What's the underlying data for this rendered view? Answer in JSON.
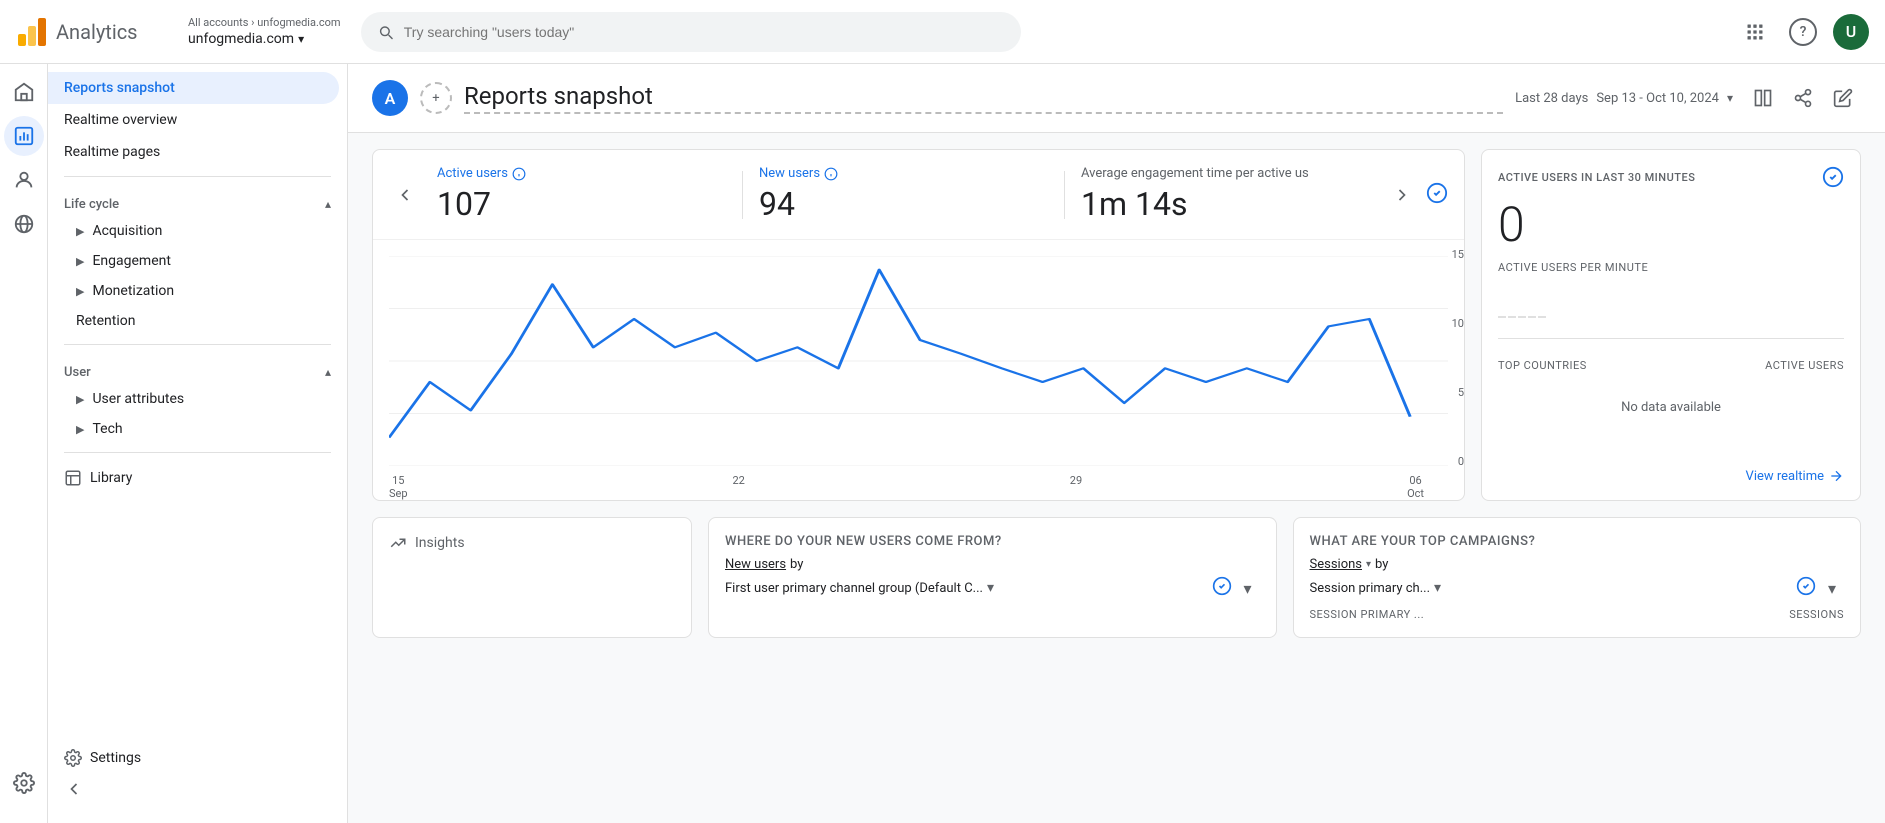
{
  "topbar": {
    "logo_text": "Analytics",
    "account_path": "All accounts › unfogmedia.com",
    "account_name": "unfogmedia.com",
    "search_placeholder": "Try searching \"users today\"",
    "avatar_letter": "U"
  },
  "sidebar_icons": [
    {
      "name": "home-icon",
      "symbol": "⌂"
    },
    {
      "name": "reports-icon",
      "symbol": "📊",
      "active": true
    },
    {
      "name": "audience-icon",
      "symbol": "👤"
    },
    {
      "name": "settings-icon-2",
      "symbol": "⚙"
    }
  ],
  "nav": {
    "main_items": [
      {
        "label": "Reports snapshot",
        "active": true
      },
      {
        "label": "Realtime overview",
        "active": false
      },
      {
        "label": "Realtime pages",
        "active": false
      }
    ],
    "sections": [
      {
        "label": "Life cycle",
        "expanded": true,
        "items": [
          {
            "label": "Acquisition",
            "expandable": true
          },
          {
            "label": "Engagement",
            "expandable": true
          },
          {
            "label": "Monetization",
            "expandable": true
          },
          {
            "label": "Retention",
            "expandable": false
          }
        ]
      },
      {
        "label": "User",
        "expanded": true,
        "items": [
          {
            "label": "User attributes",
            "expandable": true
          },
          {
            "label": "Tech",
            "expandable": true
          }
        ]
      }
    ],
    "library_item": "Library",
    "settings_item": "Settings",
    "collapse_tooltip": "Collapse"
  },
  "page_header": {
    "avatar_letter": "A",
    "title": "Reports snapshot",
    "date_range_label": "Last 28 days",
    "date_range": "Sep 13 - Oct 10, 2024"
  },
  "metrics": [
    {
      "label": "Active users",
      "value": "107",
      "has_info": true
    },
    {
      "label": "New users",
      "value": "94",
      "has_info": true
    },
    {
      "label": "Average engagement time per active us",
      "value": "1m 14s",
      "has_info": false
    }
  ],
  "chart": {
    "y_labels": [
      "15",
      "10",
      "5",
      "0"
    ],
    "x_labels": [
      {
        "date": "15",
        "month": "Sep"
      },
      {
        "date": "22",
        "month": ""
      },
      {
        "date": "29",
        "month": ""
      },
      {
        "date": "06",
        "month": "Oct"
      }
    ],
    "line_color": "#1a73e8",
    "points": [
      [
        0,
        4
      ],
      [
        4,
        7
      ],
      [
        8,
        5
      ],
      [
        12,
        9
      ],
      [
        16,
        13
      ],
      [
        20,
        8
      ],
      [
        24,
        10
      ],
      [
        28,
        7
      ],
      [
        32,
        8
      ],
      [
        36,
        6
      ],
      [
        40,
        7
      ],
      [
        44,
        5
      ],
      [
        48,
        14
      ],
      [
        52,
        7
      ],
      [
        56,
        6
      ],
      [
        60,
        5
      ],
      [
        64,
        4
      ],
      [
        68,
        5
      ],
      [
        72,
        3
      ],
      [
        76,
        5
      ],
      [
        80,
        4
      ],
      [
        84,
        5
      ],
      [
        88,
        4
      ],
      [
        92,
        10
      ],
      [
        96,
        11
      ],
      [
        100,
        3
      ]
    ]
  },
  "realtime": {
    "section_title": "ACTIVE USERS IN LAST 30 MINUTES",
    "big_number": "0",
    "sub_title": "ACTIVE USERS PER MINUTE",
    "table_title": "TOP COUNTRIES",
    "table_col2": "ACTIVE USERS",
    "no_data": "No data available",
    "view_realtime_label": "View realtime"
  },
  "bottom_section": [
    {
      "id": "insights",
      "icon": "insights-icon",
      "label": "Insights",
      "show_title": false
    },
    {
      "id": "new-users-source",
      "title": "WHERE DO YOUR NEW USERS COME FROM?",
      "sub1": "New users",
      "sub1_suffix": "by",
      "sub2": "First user primary channel group (Default C...",
      "has_check": true,
      "has_dropdown": true
    },
    {
      "id": "top-campaigns",
      "title": "WHAT ARE YOUR TOP CAMPAIGNS?",
      "sub1": "Sessions",
      "sub1_suffix": "by",
      "sub2": "Session primary ch...",
      "col_label": "SESSION PRIMARY ...",
      "col2_label": "SESSIONS",
      "has_check": true,
      "has_dropdown": true
    }
  ]
}
